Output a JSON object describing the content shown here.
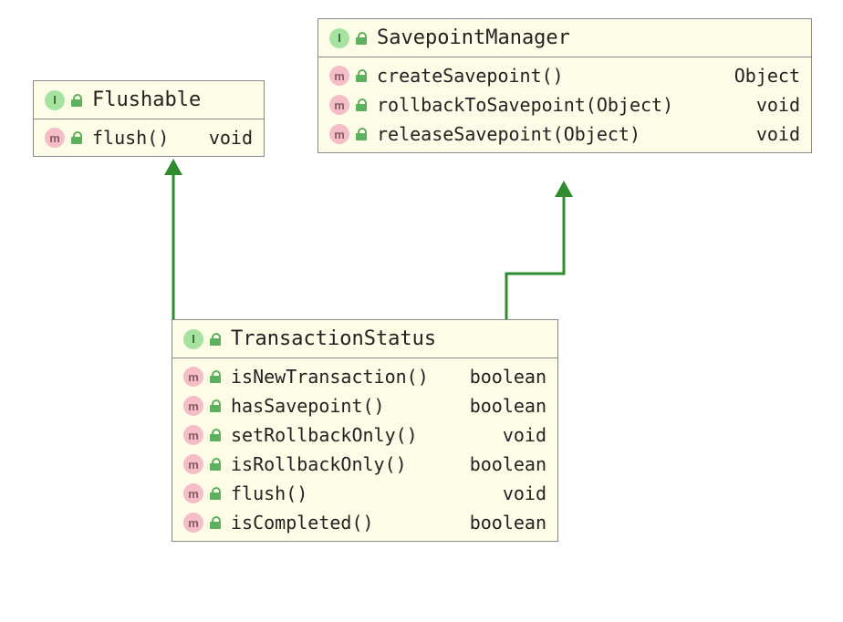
{
  "flushable": {
    "title": "Flushable",
    "members": [
      {
        "sig": "flush()",
        "ret": "void"
      }
    ]
  },
  "savepointManager": {
    "title": "SavepointManager",
    "members": [
      {
        "sig": "createSavepoint()",
        "ret": "Object"
      },
      {
        "sig": "rollbackToSavepoint(Object)",
        "ret": "void"
      },
      {
        "sig": "releaseSavepoint(Object)",
        "ret": "void"
      }
    ]
  },
  "transactionStatus": {
    "title": "TransactionStatus",
    "members": [
      {
        "sig": "isNewTransaction()",
        "ret": "boolean"
      },
      {
        "sig": "hasSavepoint()",
        "ret": "boolean"
      },
      {
        "sig": "setRollbackOnly()",
        "ret": "void"
      },
      {
        "sig": "isRollbackOnly()",
        "ret": "boolean"
      },
      {
        "sig": "flush()",
        "ret": "void"
      },
      {
        "sig": "isCompleted()",
        "ret": "boolean"
      }
    ]
  },
  "kindLabels": {
    "interface": "I",
    "method": "m"
  },
  "connectors": {
    "arrowColor": "#2e8b2e"
  }
}
